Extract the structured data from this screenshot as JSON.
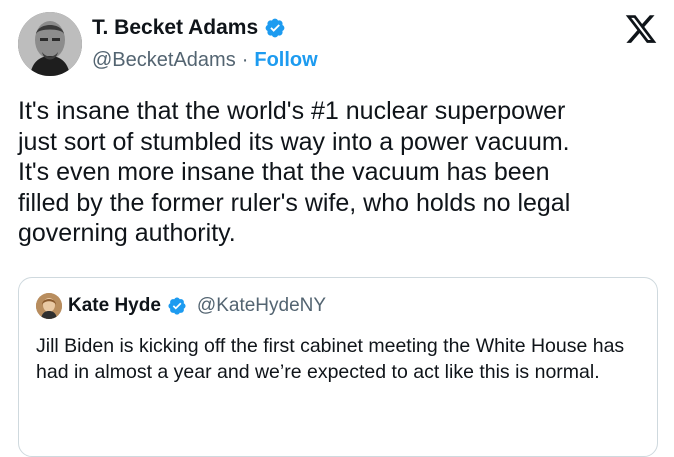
{
  "author": {
    "name": "T. Becket Adams",
    "handle": "@BecketAdams",
    "separator": "·",
    "follow_label": "Follow"
  },
  "tweet": {
    "text": "It's insane that the world's #1 nuclear superpower\njust sort of stumbled its way into a power vacuum.\nIt's even more insane that the vacuum has been\nfilled by the former ruler's wife, who holds no legal\ngoverning authority."
  },
  "quoted": {
    "name": "Kate Hyde",
    "handle": "@KateHydeNY",
    "text": "Jill Biden is kicking off the first cabinet meeting the White House has had in almost a year and we’re expected to act like this is normal."
  },
  "colors": {
    "accent": "#1d9bf0",
    "text": "#0f1419",
    "muted": "#536471",
    "border": "#cfd9de"
  },
  "icons": {
    "verified": "verified-badge-icon",
    "brand": "x-logo-icon"
  }
}
